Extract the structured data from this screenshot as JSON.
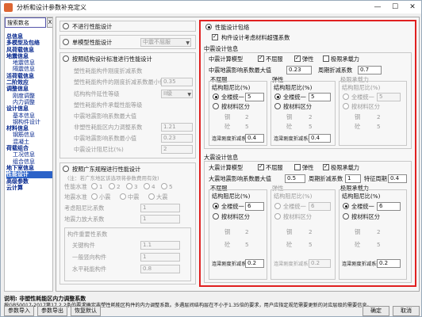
{
  "window": {
    "title": "分析和设计参数补充定义"
  },
  "search": {
    "value": "搜索数名",
    "clear": "X"
  },
  "tree": [
    {
      "label": "总信息",
      "level": 0
    },
    {
      "label": "多模型及包络",
      "level": 0
    },
    {
      "label": "风荷载信息",
      "level": 0
    },
    {
      "label": "地震信息",
      "level": 0
    },
    {
      "label": "地震信息",
      "level": 1
    },
    {
      "label": "隔震信息",
      "level": 1
    },
    {
      "label": "活荷载信息",
      "level": 0
    },
    {
      "label": "二阶效应",
      "level": 0
    },
    {
      "label": "调整信息",
      "level": 0
    },
    {
      "label": "刚度调整",
      "level": 1
    },
    {
      "label": "内力调整",
      "level": 1
    },
    {
      "label": "设计信息",
      "level": 0
    },
    {
      "label": "基本信息",
      "level": 1
    },
    {
      "label": "钢构件设计",
      "level": 1
    },
    {
      "label": "材料信息",
      "level": 0
    },
    {
      "label": "钢筋信息",
      "level": 1
    },
    {
      "label": "混凝土",
      "level": 1
    },
    {
      "label": "荷载组合",
      "level": 0
    },
    {
      "label": "工况信息",
      "level": 1
    },
    {
      "label": "组合信息",
      "level": 1
    },
    {
      "label": "地下室信息",
      "level": 0
    },
    {
      "label": "性能设计",
      "level": 0,
      "selected": true
    },
    {
      "label": "高级参数",
      "level": 0
    },
    {
      "label": "云计算",
      "level": 0
    }
  ],
  "left_panel": {
    "no_perf": "不进行性能设计",
    "single_perf": "单模型性能设计",
    "single_select": "中震不屈服",
    "standard_design": "按照结构设计标准进行性能设计",
    "rows": [
      {
        "label": "塑性耗能构件刚度折减系数",
        "value": ""
      },
      {
        "label": "塑性耗能构件的刚度折减系数最小值",
        "value": "0.35"
      },
      {
        "label": "结构构件延性等级",
        "value": "II级"
      },
      {
        "label": "塑性耗能构件承载性能等级",
        "value": "性能7"
      },
      {
        "label": "中震地震影响系数最大值",
        "value": "0.23"
      },
      {
        "label": "大震地震影响系数最大值",
        "value": ""
      },
      {
        "label": "非塑性耗能区内力调整系数",
        "value": "1.21"
      },
      {
        "label": "中震地震影响系数最小值",
        "value": "0.23"
      },
      {
        "label": "中震设计阻尼比(%)",
        "value": "2"
      }
    ],
    "guangdong": "按照广东规程进行性能设计",
    "guangdong_note": "(注：若广东地区该选项将参数费用有效)",
    "perf_level_label": "性能水准",
    "perf_levels": [
      "1",
      "2",
      "3",
      "4",
      "5"
    ],
    "eq_level_label": "地震水准",
    "eq_levels": [
      "小震",
      "中震",
      "大震"
    ],
    "gd_rows": [
      {
        "label": "考虑阻尼比系数",
        "value": "1"
      },
      {
        "label": "地震力放大系数",
        "value": "1"
      }
    ],
    "member_coef_title": "构件重要性系数",
    "member_rows": [
      {
        "label": "关键构件",
        "value": "1.1"
      },
      {
        "label": "一般竖向构件",
        "value": "1"
      },
      {
        "label": "水平耗能构件",
        "value": "0.8"
      }
    ]
  },
  "right_panel": {
    "envelope": "性能设计包络",
    "member_envelope": "构件设计考虑材料超强系数",
    "mid": {
      "title": "中震设计信息",
      "calc_model": "中震计算模型",
      "opt_no_yield": "不屈服",
      "opt_elastic": "弹性",
      "opt_limit": "极限承载力",
      "alpha_label": "中震地震影响系数最大值",
      "alpha": "0.23",
      "period_label": "周期折减系数",
      "period": "0.7",
      "no_yield_title": "不屈服",
      "elastic_title": "弹性",
      "limit_title": "极限承载力",
      "damping_label": "结构阻尼比(%)",
      "uniform": "全楼统一",
      "uniform_val": "5",
      "by_material": "按材料区分",
      "steel": "钢",
      "steel_val": "2",
      "concrete": "砼",
      "concrete_val": "5",
      "beam_coef_label": "连梁刚度折减系数",
      "beam_coef": "0.4"
    },
    "big": {
      "title": "大震设计信息",
      "calc_model": "大震计算模型",
      "opt_no_yield": "不屈服",
      "opt_elastic": "弹性",
      "opt_limit": "极限承载力",
      "alpha_label": "大震地震影响系数最大值",
      "alpha": "0.5",
      "period_label": "周期折减系数",
      "period": "1",
      "special_label": "特征周期",
      "special": "0.4",
      "no_yield_title": "不屈服",
      "elastic_title": "弹性",
      "limit_title": "极限承载力",
      "damping_label": "结构阻尼比(%)",
      "uniform": "全楼统一",
      "uniform_val": "6",
      "by_material": "按材料区分",
      "steel": "钢",
      "steel_val": "2",
      "concrete": "砼",
      "concrete_val": "5",
      "beam_coef_label": "连梁刚度折减系数",
      "beam_coef": "0.2"
    }
  },
  "description": {
    "title": "说明: 非塑性耗能区内力调整系数",
    "text": "按GB50017-2017第17.2.2条的要求确定非塑性耗能区构件的内力调整系数。多遇层间结构层在不小于1.35倍的要求，用户应指定规范需要更新的对应层级的需要信息。"
  },
  "buttons": {
    "import": "参数导入",
    "export": "参数导出",
    "restore": "恢复默认",
    "ok": "确定",
    "cancel": "取消"
  }
}
